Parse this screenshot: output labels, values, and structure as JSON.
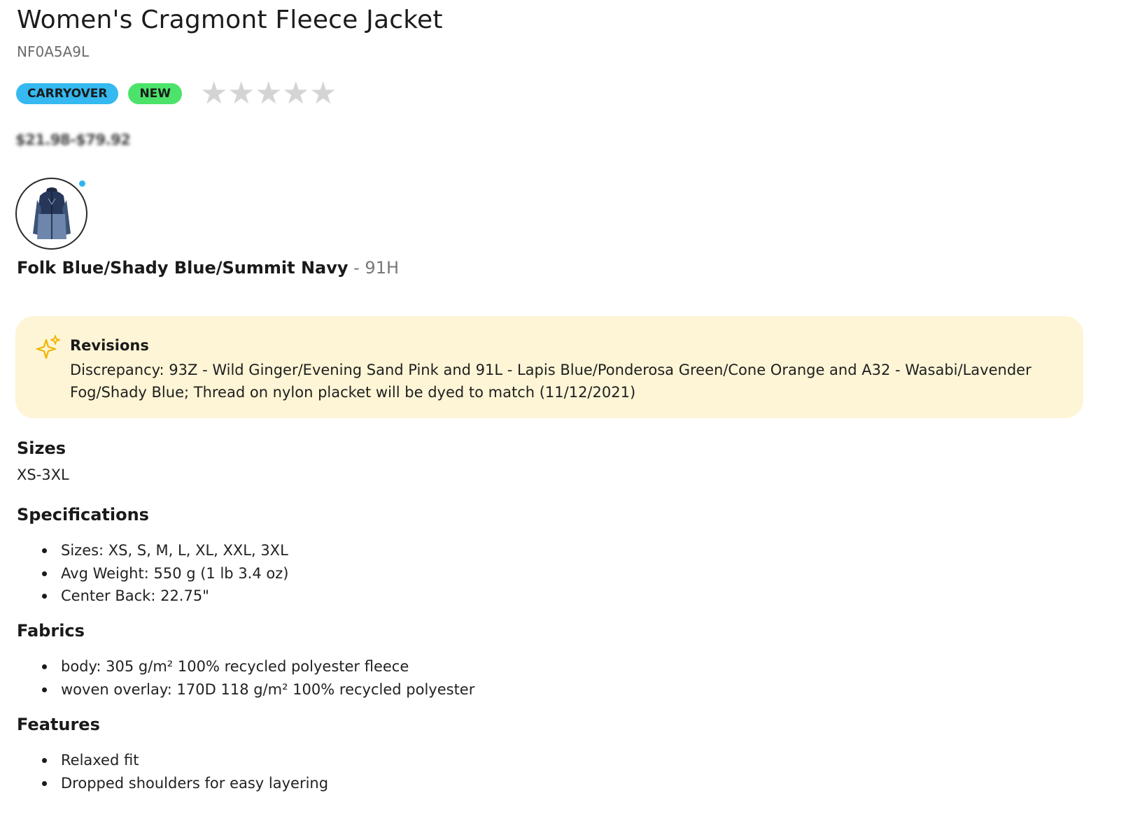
{
  "product": {
    "title": "Women's Cragmont Fleece Jacket",
    "sku": "NF0A5A9L"
  },
  "badges": {
    "carryover": "CARRYOVER",
    "new": "NEW"
  },
  "rating": {
    "stars_filled": 0,
    "stars_total": 5,
    "star_color": "#d4d4d4"
  },
  "price": {
    "range": "$21.98-$79.92"
  },
  "colorway": {
    "name": "Folk Blue/Shady Blue/Summit Navy",
    "code": " - 91H",
    "icon": "jacket-thumbnail",
    "selected_dot_color": "#2fb4f2"
  },
  "revisions": {
    "title": "Revisions",
    "text": "Discrepancy: 93Z - Wild Ginger/Evening Sand Pink and 91L - Lapis Blue/Ponderosa Green/Cone Orange and A32 - Wasabi/Lavender Fog/Shady Blue; Thread on nylon placket will be dyed to match (11/12/2021)",
    "icon": "sparkle-icon",
    "background": "#fdf5d6"
  },
  "sizes": {
    "heading": "Sizes",
    "value": "XS-3XL"
  },
  "specifications": {
    "heading": "Specifications",
    "items": [
      "Sizes: XS, S, M, L, XL, XXL, 3XL",
      "Avg Weight: 550 g (1 lb 3.4 oz)",
      "Center Back: 22.75\""
    ]
  },
  "fabrics": {
    "heading": "Fabrics",
    "items": [
      "body: 305 g/m² 100% recycled polyester fleece",
      "woven overlay: 170D 118 g/m² 100% recycled polyester"
    ]
  },
  "features": {
    "heading": "Features",
    "items": [
      "Relaxed fit",
      "Dropped shoulders for easy layering"
    ]
  },
  "colors": {
    "carryover": "#35b9f0",
    "new": "#4be36a"
  }
}
